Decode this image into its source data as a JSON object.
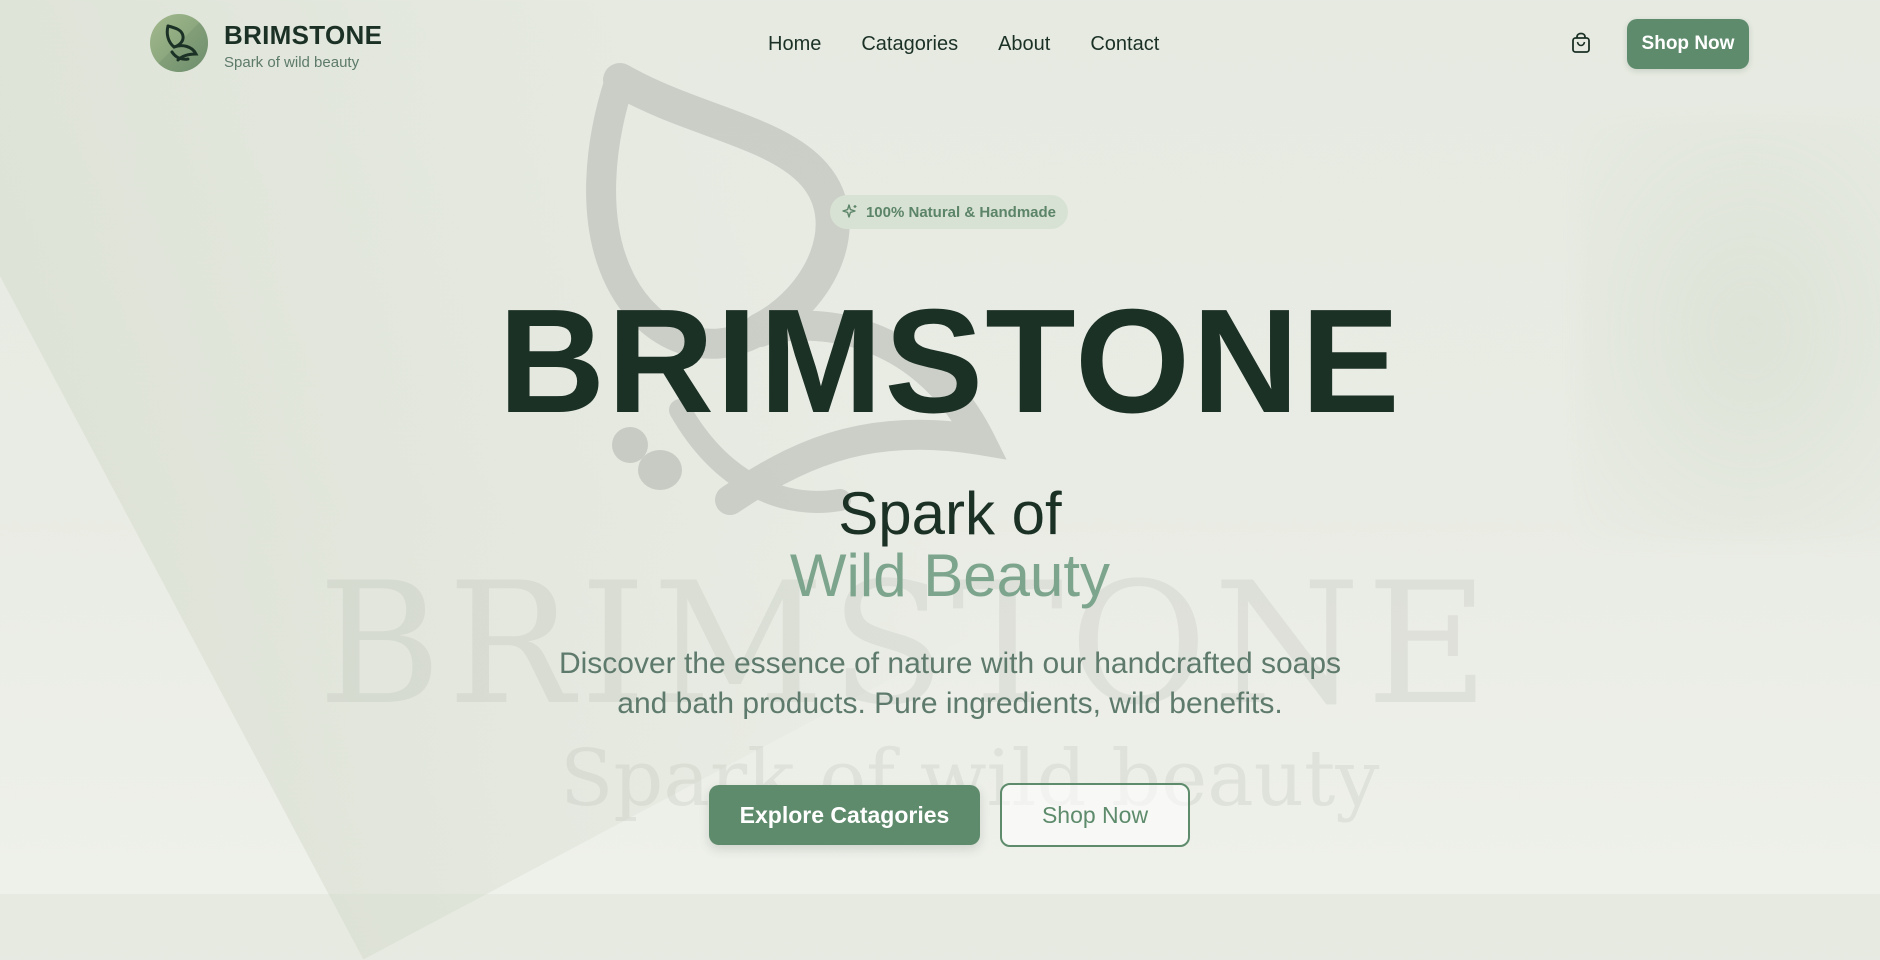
{
  "brand": {
    "name": "BRIMSTONE",
    "tagline": "Spark of wild beauty"
  },
  "nav": {
    "items": [
      {
        "label": "Home"
      },
      {
        "label": "Catagories"
      },
      {
        "label": "About"
      },
      {
        "label": "Contact"
      }
    ]
  },
  "header": {
    "cart_icon": "shopping-bag-icon",
    "shop_now_label": "Shop Now"
  },
  "hero": {
    "badge_icon": "sparkle-icon",
    "badge_text": "100% Natural & Handmade",
    "big_word": "BRIMSTONE",
    "headline_line1": "Spark of",
    "headline_line2": "Wild Beauty",
    "description": "Discover the essence of nature with our handcrafted soaps and bath products. Pure ingredients, wild benefits.",
    "primary_cta": "Explore Catagories",
    "secondary_cta": "Shop Now"
  },
  "watermark": {
    "word": "BRIMSTONE",
    "tagline": "Spark of wild beauty"
  },
  "colors": {
    "accent": "#5e8b6c",
    "accent_light": "#7da58d",
    "text_dark": "#1c3126",
    "background": "#e8ebe3"
  }
}
